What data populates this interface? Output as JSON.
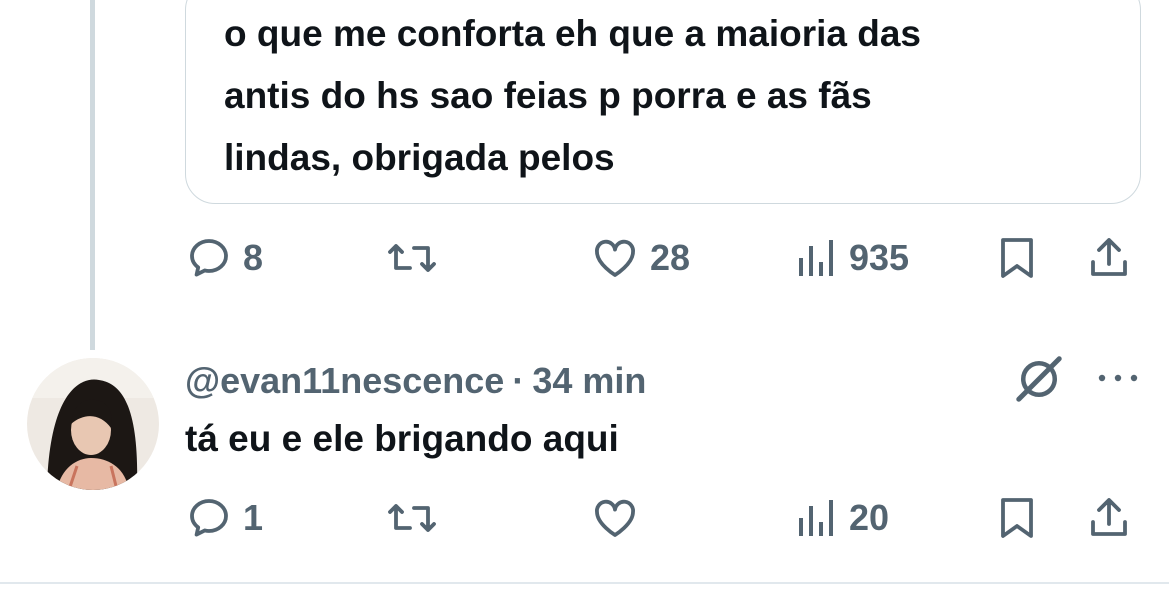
{
  "quoted_tweet": {
    "lines": [
      "o que me conforta eh que a maioria das",
      "antis do hs sao feias p porra e as fãs",
      "lindas, obrigada pelos"
    ]
  },
  "main_actions": {
    "replies": "8",
    "likes": "28",
    "views": "935"
  },
  "reply": {
    "handle": "@evan11nescence",
    "separator": "·",
    "time": "34 min",
    "text": "tá eu e ele brigando aqui",
    "actions": {
      "replies": "1",
      "views": "20"
    }
  },
  "colors": {
    "text_primary": "#0f1419",
    "text_secondary": "#536471",
    "border": "#cfd9de",
    "thread_line": "#cfd9de"
  },
  "icons": [
    "reply-icon",
    "retweet-icon",
    "like-icon",
    "views-icon",
    "bookmark-icon",
    "share-icon",
    "grok-icon",
    "more-icon"
  ]
}
